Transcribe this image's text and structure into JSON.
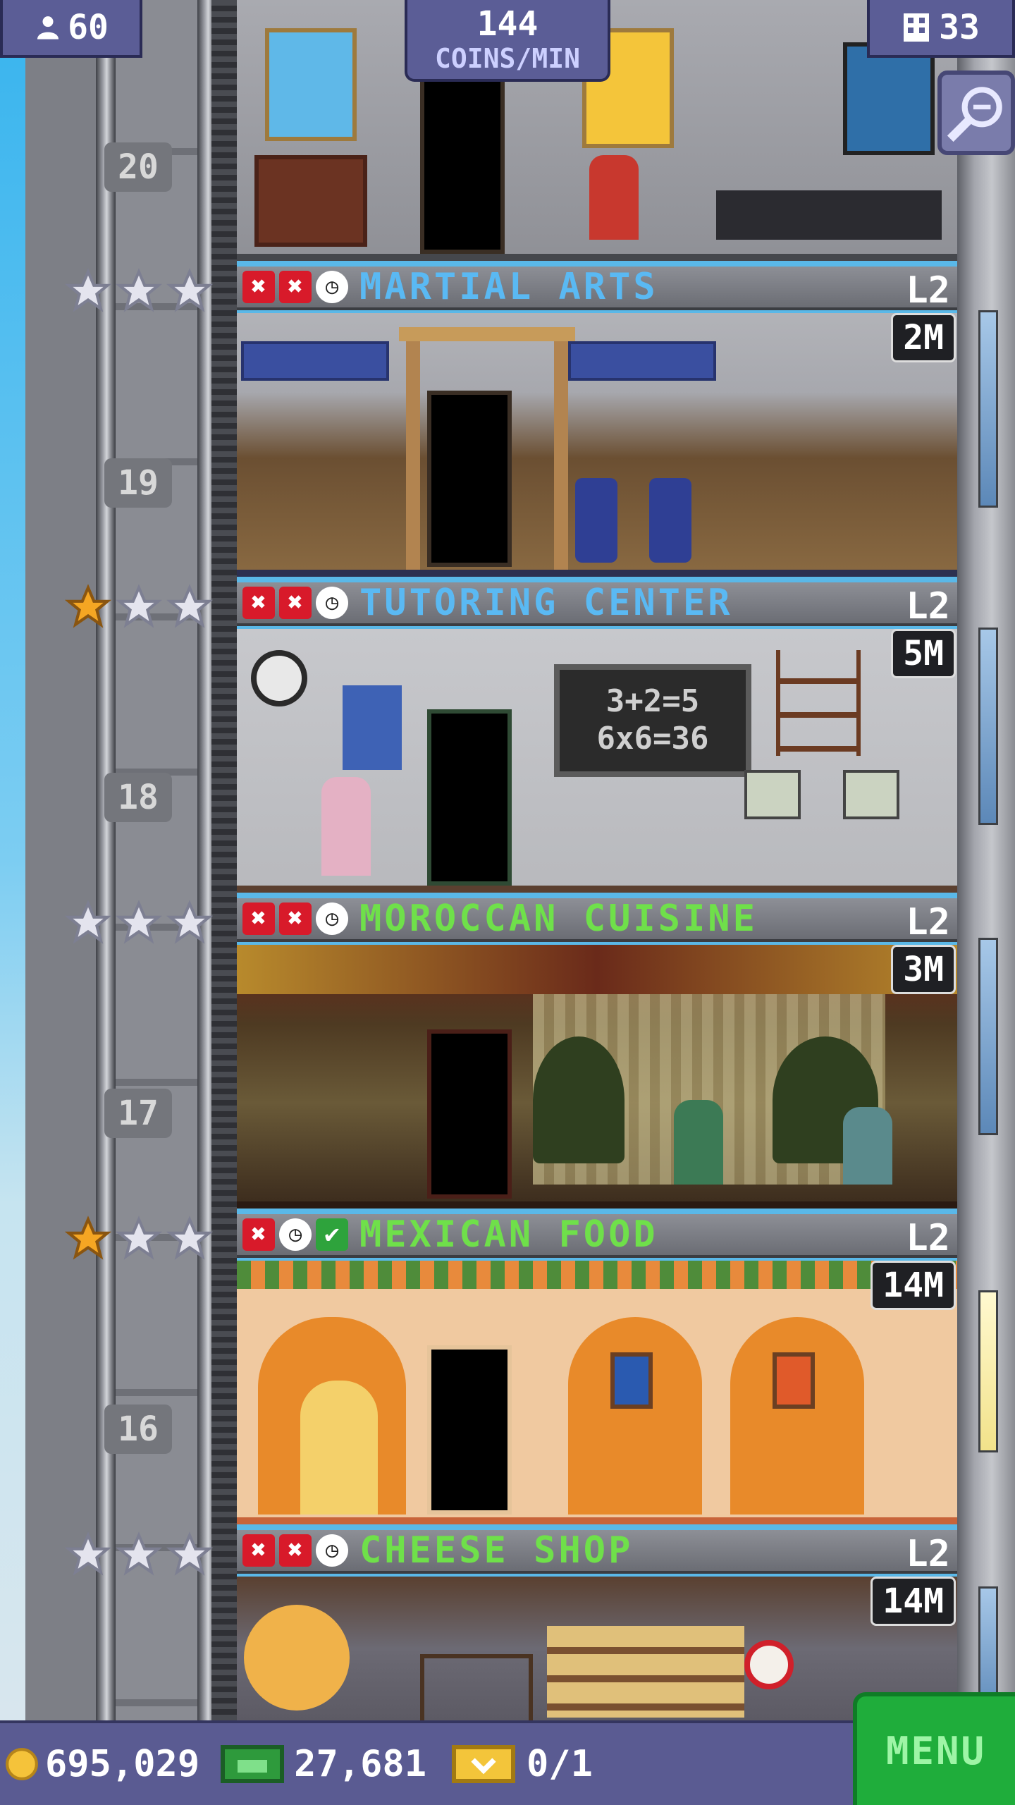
{
  "top_bar": {
    "population": "60",
    "coins_per_min_value": "144",
    "coins_per_min_label": "COINS/MIN",
    "floor_count": "33"
  },
  "floors": [
    {
      "number": "20",
      "name": "",
      "level": "",
      "income": "",
      "stars_gold": 0
    },
    {
      "number": "19",
      "name": "MARTIAL ARTS",
      "level": "L2",
      "income": "2M",
      "stars_gold": 0,
      "name_color": "#5ab9f3",
      "statuses": [
        "x",
        "x",
        "clock"
      ]
    },
    {
      "number": "18",
      "name": "TUTORING CENTER",
      "level": "L2",
      "income": "5M",
      "stars_gold": 1,
      "name_color": "#5ab9f3",
      "statuses": [
        "x",
        "x",
        "clock"
      ]
    },
    {
      "number": "17",
      "name": "MOROCCAN CUISINE",
      "level": "L2",
      "income": "3M",
      "stars_gold": 0,
      "name_color": "#6fe04a",
      "statuses": [
        "x",
        "x",
        "clock"
      ]
    },
    {
      "number": "16",
      "name": "MEXICAN FOOD",
      "level": "L2",
      "income": "14M",
      "stars_gold": 1,
      "name_color": "#6fe04a",
      "statuses": [
        "x",
        "clock",
        "check"
      ]
    },
    {
      "number": "",
      "name": "CHEESE SHOP",
      "level": "L2",
      "income": "14M",
      "stars_gold": 0,
      "name_color": "#6fe04a",
      "statuses": [
        "x",
        "x",
        "clock"
      ]
    }
  ],
  "chalkboard": {
    "line1": "3+2=5",
    "line2": "6x6=36"
  },
  "bottom_bar": {
    "coins": "695,029",
    "bux": "27,681",
    "tickets": "0/1",
    "menu_label": "MENU"
  },
  "status_glyphs": {
    "x": "✖",
    "clock": "◷",
    "check": "✔"
  },
  "colors": {
    "accent_blue": "#5ab9f3",
    "accent_green": "#6fe04a",
    "menu_green": "#1fad3b",
    "hud_purple": "#5b5d96"
  }
}
